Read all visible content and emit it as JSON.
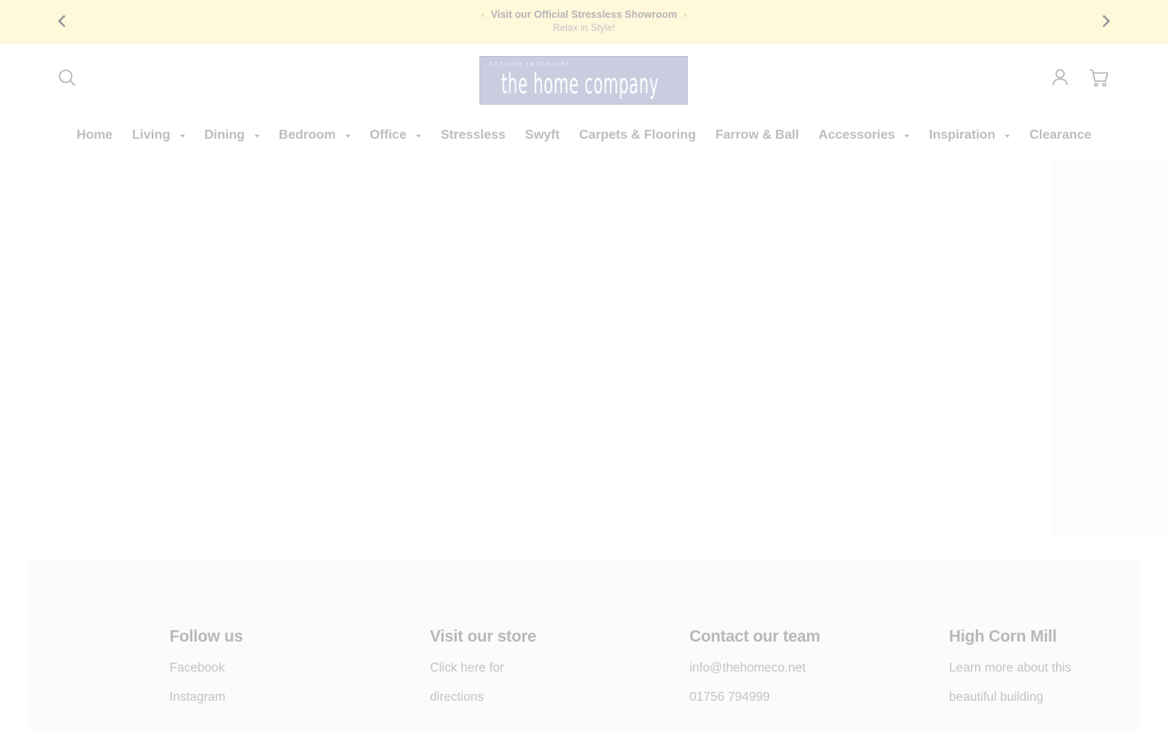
{
  "announcement": {
    "line1": "Visit our Official Stressless Showroom",
    "line2": "Relax in Style!",
    "prev_icon": "chevron-left-icon",
    "next_icon": "chevron-right-icon"
  },
  "header": {
    "logo": {
      "tagline": "STYLISH INTERIORS",
      "name": "the home company"
    },
    "icons": {
      "search": "search-icon",
      "account": "user-icon",
      "cart": "cart-icon"
    }
  },
  "nav": {
    "items": [
      {
        "label": "Home",
        "has_dropdown": false
      },
      {
        "label": "Living",
        "has_dropdown": true
      },
      {
        "label": "Dining",
        "has_dropdown": true
      },
      {
        "label": "Bedroom",
        "has_dropdown": true
      },
      {
        "label": "Office",
        "has_dropdown": true
      },
      {
        "label": "Stressless",
        "has_dropdown": false
      },
      {
        "label": "Swyft",
        "has_dropdown": false
      },
      {
        "label": "Carpets & Flooring",
        "has_dropdown": false
      },
      {
        "label": "Farrow & Ball",
        "has_dropdown": false
      },
      {
        "label": "Accessories",
        "has_dropdown": true
      },
      {
        "label": "Inspiration",
        "has_dropdown": true
      },
      {
        "label": "Clearance",
        "has_dropdown": false
      }
    ]
  },
  "footer": {
    "columns": [
      {
        "title": "Follow us",
        "links": [
          "Facebook",
          "Instagram"
        ]
      },
      {
        "title": "Visit our store",
        "links": [
          "Click here for",
          "directions"
        ]
      },
      {
        "title": "Contact our team",
        "links": [
          "info@thehomeco.net",
          "01756 794999"
        ]
      },
      {
        "title": "High Corn Mill",
        "links": [
          "Learn more about this",
          "beautiful building"
        ]
      }
    ]
  },
  "colors": {
    "announcement_bg": "#fff8db",
    "logo_bg": "#c9cddf",
    "text_muted": "#bdbdbd",
    "footer_bg": "#fbfbfb"
  }
}
